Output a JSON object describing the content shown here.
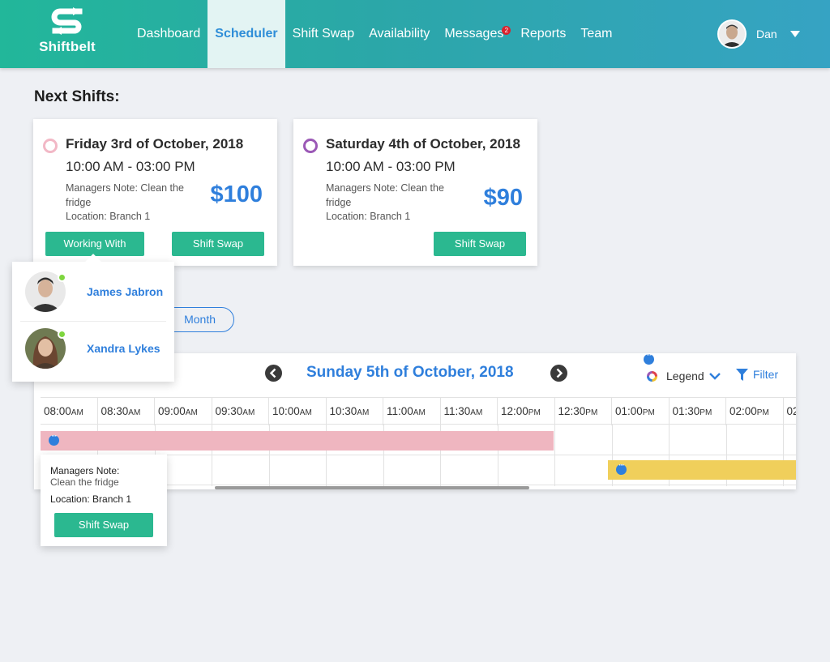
{
  "app": {
    "name": "Shiftbelt"
  },
  "nav": {
    "items": [
      {
        "label": "Dashboard"
      },
      {
        "label": "Scheduler",
        "active": true
      },
      {
        "label": "Shift Swap"
      },
      {
        "label": "Availability"
      },
      {
        "label": "Messages",
        "badge": "2"
      },
      {
        "label": "Reports"
      },
      {
        "label": "Team"
      }
    ]
  },
  "user": {
    "name": "Dan"
  },
  "next_shifts": {
    "title": "Next Shifts:",
    "cards": [
      {
        "date": "Friday 3rd of October, 2018",
        "time": "10:00 AM - 03:00 PM",
        "note": "Managers Note: Clean the fridge",
        "location": "Location: Branch 1",
        "price": "$100",
        "ring_color": "#f2b8c6",
        "working_with_label": "Working With",
        "swap_label": "Shift Swap"
      },
      {
        "date": "Saturday 4th of October, 2018",
        "time": "10:00 AM - 03:00 PM",
        "note": "Managers Note: Clean the fridge",
        "location": "Location: Branch 1",
        "price": "$90",
        "ring_color": "#9b59b6",
        "swap_label": "Shift Swap"
      }
    ]
  },
  "working_with": {
    "people": [
      {
        "name": "James Jabron",
        "status": "online"
      },
      {
        "name": "Xandra Lykes",
        "status": "online"
      }
    ]
  },
  "view_toggle": {
    "month_label": "Month"
  },
  "scheduler": {
    "date": "Sunday 5th of October, 2018",
    "legend_label": "Legend",
    "filter_label": "Filter",
    "hours": [
      {
        "t": "08:00",
        "p": "AM"
      },
      {
        "t": "08:30",
        "p": "AM"
      },
      {
        "t": "09:00",
        "p": "AM"
      },
      {
        "t": "09:30",
        "p": "AM"
      },
      {
        "t": "10:00",
        "p": "AM"
      },
      {
        "t": "10:30",
        "p": "AM"
      },
      {
        "t": "11:00",
        "p": "AM"
      },
      {
        "t": "11:30",
        "p": "AM"
      },
      {
        "t": "12:00",
        "p": "PM"
      },
      {
        "t": "12:30",
        "p": "PM"
      },
      {
        "t": "01:00",
        "p": "PM"
      },
      {
        "t": "01:30",
        "p": "PM"
      },
      {
        "t": "02:00",
        "p": "PM"
      },
      {
        "t": "02",
        "p": ""
      }
    ],
    "colors": {
      "shift_pink": "#efb6c0",
      "shift_yellow": "#f0cf5b",
      "accent": "#2f7fdc",
      "button": "#2bb890"
    }
  },
  "note_tooltip": {
    "note_label": "Managers Note:",
    "note_value": "Clean the fridge",
    "location": "Location: Branch 1",
    "swap_label": "Shift Swap"
  }
}
